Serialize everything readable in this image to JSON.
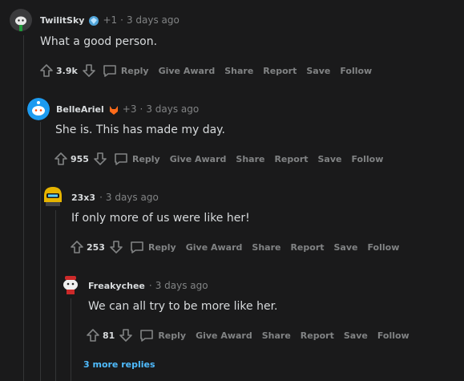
{
  "actions": {
    "reply": "Reply",
    "give_award": "Give Award",
    "share": "Share",
    "report": "Report",
    "save": "Save",
    "follow": "Follow"
  },
  "comments": [
    {
      "username": "TwilitSky",
      "flair_count": "+1",
      "separator": "·",
      "time": "3 days ago",
      "text": "What a good person.",
      "score": "3.9k"
    },
    {
      "username": "BelleAriel",
      "flair_count": "+3",
      "separator": "·",
      "time": "3 days ago",
      "text": "She is. This has made my day.",
      "score": "955"
    },
    {
      "username": "23x3",
      "separator": "·",
      "time": "3 days ago",
      "text": "If only more of us were like her!",
      "score": "253"
    },
    {
      "username": "Freakychee",
      "separator": "·",
      "time": "3 days ago",
      "text": "We can all try to be more like her.",
      "score": "81"
    }
  ],
  "more_replies": "3 more replies",
  "colors": {
    "background": "#1a1a1b",
    "text": "#d7dadc",
    "meta": "#818384",
    "link": "#4fbcff"
  }
}
